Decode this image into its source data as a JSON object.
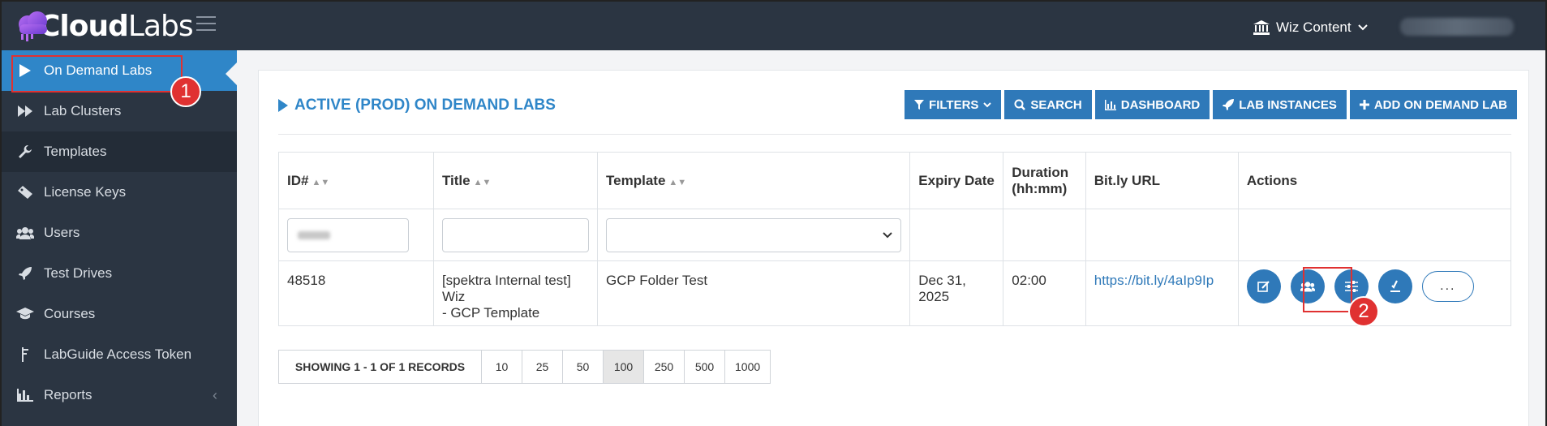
{
  "brand": {
    "name_bold": "Cloud",
    "name_light": "Labs"
  },
  "header": {
    "org_label": "Wiz Content"
  },
  "sidebar": {
    "items": [
      {
        "label": "On Demand Labs",
        "icon": "play-icon"
      },
      {
        "label": "Lab Clusters",
        "icon": "fast-forward-icon"
      },
      {
        "label": "Templates",
        "icon": "wrench-icon"
      },
      {
        "label": "License Keys",
        "icon": "ticket-icon"
      },
      {
        "label": "Users",
        "icon": "users-icon"
      },
      {
        "label": "Test Drives",
        "icon": "rocket-icon"
      },
      {
        "label": "Courses",
        "icon": "graduation-cap-icon"
      },
      {
        "label": "LabGuide Access Token",
        "icon": "token-icon"
      },
      {
        "label": "Reports",
        "icon": "bar-chart-icon"
      }
    ]
  },
  "main": {
    "title": "ACTIVE (PROD) ON DEMAND LABS",
    "toolbar": {
      "filters": "FILTERS",
      "search": "SEARCH",
      "dashboard": "DASHBOARD",
      "lab_instances": "LAB INSTANCES",
      "add": "ADD ON DEMAND LAB"
    },
    "table": {
      "headers": {
        "id": "ID#",
        "title": "Title",
        "template": "Template",
        "expiry": "Expiry Date",
        "duration_line1": "Duration",
        "duration_line2": "(hh:mm)",
        "bitly": "Bit.ly URL",
        "actions": "Actions"
      },
      "rows": [
        {
          "id": "48518",
          "title_line1": "[spektra Internal test] Wiz",
          "title_line2": "- GCP Template",
          "template": "GCP Folder Test",
          "expiry": "Dec 31, 2025",
          "duration": "02:00",
          "bitly": "https://bit.ly/4aIp9Ip",
          "more": "..."
        }
      ]
    },
    "pager": {
      "info": "SHOWING 1 - 1 OF 1 RECORDS",
      "sizes": [
        "10",
        "25",
        "50",
        "100",
        "250",
        "500",
        "1000"
      ],
      "selected": "100"
    }
  },
  "annotations": {
    "step1": "1",
    "step2": "2"
  },
  "colors": {
    "accent": "#2f79b9",
    "sidebar": "#2b3542",
    "highlight": "#e03131"
  }
}
